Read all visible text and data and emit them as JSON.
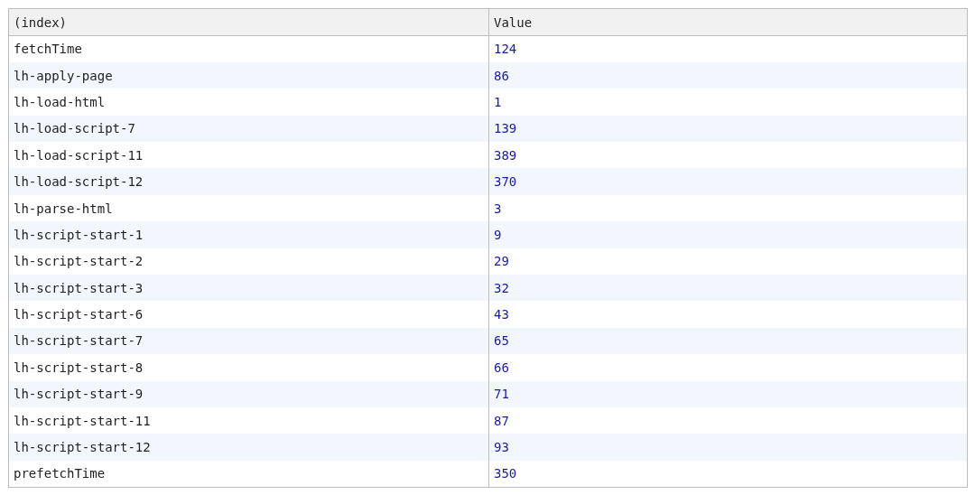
{
  "table": {
    "columns": [
      "(index)",
      "Value"
    ],
    "rows": [
      {
        "index": "fetchTime",
        "value": "124"
      },
      {
        "index": "lh-apply-page",
        "value": "86"
      },
      {
        "index": "lh-load-html",
        "value": "1"
      },
      {
        "index": "lh-load-script-7",
        "value": "139"
      },
      {
        "index": "lh-load-script-11",
        "value": "389"
      },
      {
        "index": "lh-load-script-12",
        "value": "370"
      },
      {
        "index": "lh-parse-html",
        "value": "3"
      },
      {
        "index": "lh-script-start-1",
        "value": "9"
      },
      {
        "index": "lh-script-start-2",
        "value": "29"
      },
      {
        "index": "lh-script-start-3",
        "value": "32"
      },
      {
        "index": "lh-script-start-6",
        "value": "43"
      },
      {
        "index": "lh-script-start-7",
        "value": "65"
      },
      {
        "index": "lh-script-start-8",
        "value": "66"
      },
      {
        "index": "lh-script-start-9",
        "value": "71"
      },
      {
        "index": "lh-script-start-11",
        "value": "87"
      },
      {
        "index": "lh-script-start-12",
        "value": "93"
      },
      {
        "index": "prefetchTime",
        "value": "350"
      }
    ]
  }
}
